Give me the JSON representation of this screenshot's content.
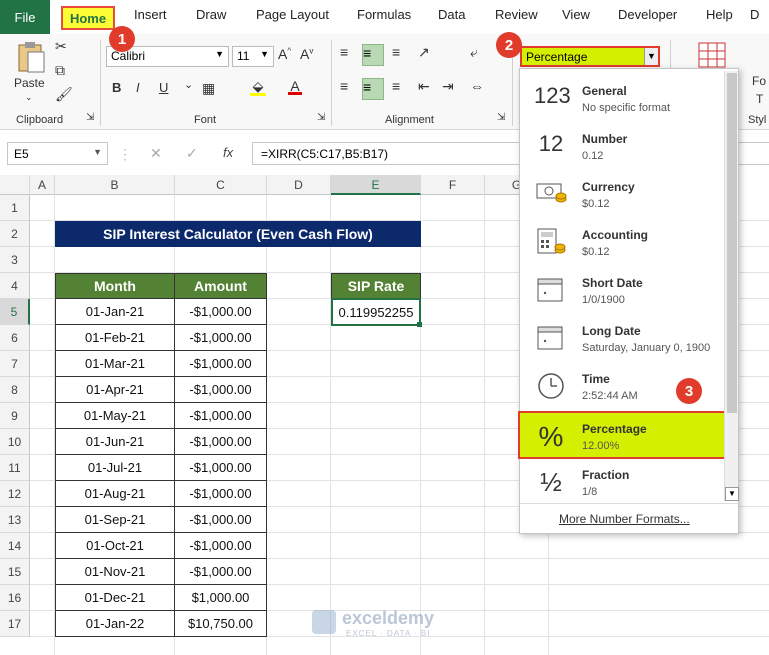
{
  "tabs": [
    "File",
    "Home",
    "Insert",
    "Draw",
    "Page Layout",
    "Formulas",
    "Data",
    "Review",
    "View",
    "Developer",
    "Help"
  ],
  "clipboard": {
    "paste_label": "Paste",
    "group_label": "Clipboard"
  },
  "font": {
    "name": "Calibri",
    "size": "11",
    "group_label": "Font",
    "bold": "B",
    "italic": "I",
    "underline": "U"
  },
  "alignment": {
    "group_label": "Alignment"
  },
  "number_format": {
    "selected": "Percentage"
  },
  "formula_bar": {
    "name_box": "E5",
    "fx": "fx",
    "formula": "=XIRR(C5:C17,B5:B17)"
  },
  "columns": [
    "A",
    "B",
    "C",
    "D",
    "E",
    "F",
    "G"
  ],
  "rows": [
    "1",
    "2",
    "3",
    "4",
    "5",
    "6",
    "7",
    "8",
    "9",
    "10",
    "11",
    "12",
    "13",
    "14",
    "15",
    "16",
    "17"
  ],
  "sheet": {
    "title": "SIP Interest Calculator (Even Cash Flow)",
    "headers": {
      "month": "Month",
      "amount": "Amount",
      "rate": "SIP Rate"
    },
    "rate_value": "0.119952255",
    "table": [
      {
        "month": "01-Jan-21",
        "amount": "-$1,000.00"
      },
      {
        "month": "01-Feb-21",
        "amount": "-$1,000.00"
      },
      {
        "month": "01-Mar-21",
        "amount": "-$1,000.00"
      },
      {
        "month": "01-Apr-21",
        "amount": "-$1,000.00"
      },
      {
        "month": "01-May-21",
        "amount": "-$1,000.00"
      },
      {
        "month": "01-Jun-21",
        "amount": "-$1,000.00"
      },
      {
        "month": "01-Jul-21",
        "amount": "-$1,000.00"
      },
      {
        "month": "01-Aug-21",
        "amount": "-$1,000.00"
      },
      {
        "month": "01-Sep-21",
        "amount": "-$1,000.00"
      },
      {
        "month": "01-Oct-21",
        "amount": "-$1,000.00"
      },
      {
        "month": "01-Nov-21",
        "amount": "-$1,000.00"
      },
      {
        "month": "01-Dec-21",
        "amount": "$1,000.00"
      },
      {
        "month": "01-Jan-22",
        "amount": "$10,750.00"
      }
    ]
  },
  "formats": [
    {
      "name": "General",
      "sample": "No specific format",
      "icon": "123"
    },
    {
      "name": "Number",
      "sample": "0.12",
      "icon": "12"
    },
    {
      "name": "Currency",
      "sample": "$0.12",
      "icon": "currency-icon"
    },
    {
      "name": "Accounting",
      "sample": " $0.12",
      "icon": "accounting-icon"
    },
    {
      "name": "Short Date",
      "sample": "1/0/1900",
      "icon": "calendar-icon"
    },
    {
      "name": "Long Date",
      "sample": "Saturday, January 0, 1900",
      "icon": "calendar-icon"
    },
    {
      "name": "Time",
      "sample": "2:52:44 AM",
      "icon": "clock-icon"
    },
    {
      "name": "Percentage",
      "sample": "12.00%",
      "icon": "%"
    },
    {
      "name": "Fraction",
      "sample": " 1/8",
      "icon": "½"
    }
  ],
  "more_formats": "More Number Formats...",
  "badges": [
    "1",
    "2",
    "3"
  ],
  "watermark": {
    "brand": "exceldemy",
    "tagline": "EXCEL · DATA · BI"
  },
  "colors": {
    "excel_green": "#217346",
    "header_green": "#548235",
    "title_navy": "#0c2a6b",
    "highlight": "#d4ef00",
    "badge_red": "#e03b2b"
  }
}
